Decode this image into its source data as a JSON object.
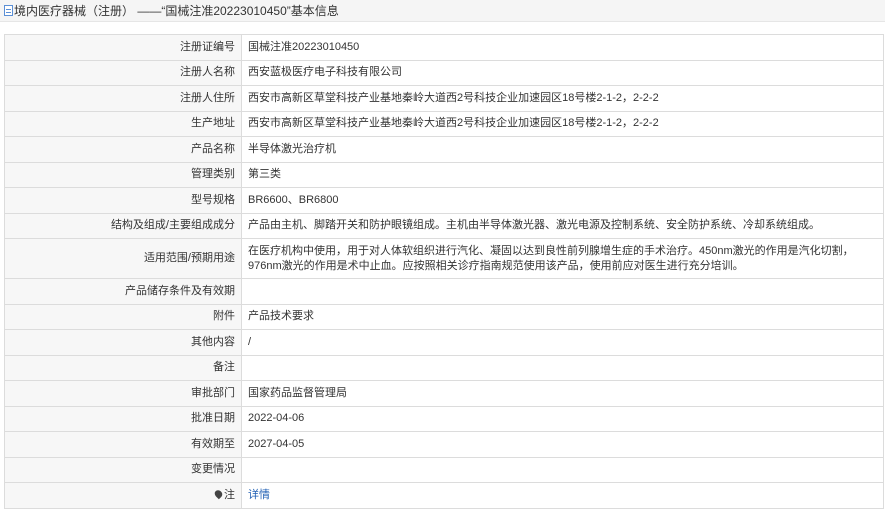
{
  "header": {
    "title": "境内医疗器械（注册） ——“国械注准20223010450”基本信息"
  },
  "rows": [
    {
      "label": "注册证编号",
      "value": "国械注准20223010450"
    },
    {
      "label": "注册人名称",
      "value": "西安蓝极医疗电子科技有限公司"
    },
    {
      "label": "注册人住所",
      "value": "西安市高新区草堂科技产业基地秦岭大道西2号科技企业加速园区18号楼2-1-2，2-2-2"
    },
    {
      "label": "生产地址",
      "value": "西安市高新区草堂科技产业基地秦岭大道西2号科技企业加速园区18号楼2-1-2，2-2-2"
    },
    {
      "label": "产品名称",
      "value": "半导体激光治疗机"
    },
    {
      "label": "管理类别",
      "value": "第三类"
    },
    {
      "label": "型号规格",
      "value": "BR6600、BR6800"
    },
    {
      "label": "结构及组成/主要组成成分",
      "value": "产品由主机、脚踏开关和防护眼镜组成。主机由半导体激光器、激光电源及控制系统、安全防护系统、冷却系统组成。"
    },
    {
      "label": "适用范围/预期用途",
      "value": "在医疗机构中使用，用于对人体软组织进行汽化、凝固以达到良性前列腺增生症的手术治疗。450nm激光的作用是汽化切割，976nm激光的作用是术中止血。应按照相关诊疗指南规范使用该产品，使用前应对医生进行充分培训。"
    },
    {
      "label": "产品储存条件及有效期",
      "value": ""
    },
    {
      "label": "附件",
      "value": "产品技术要求"
    },
    {
      "label": "其他内容",
      "value": "/"
    },
    {
      "label": "备注",
      "value": ""
    },
    {
      "label": "审批部门",
      "value": "国家药品监督管理局"
    },
    {
      "label": "批准日期",
      "value": "2022-04-06"
    },
    {
      "label": "有效期至",
      "value": "2027-04-05"
    },
    {
      "label": "变更情况",
      "value": ""
    },
    {
      "label": "注",
      "value": "详情"
    }
  ],
  "icons": {
    "title_icon": "document-icon",
    "note_icon": "pin-icon"
  },
  "colors": {
    "link": "#1f5fb4",
    "label_bg": "#f7f7f7",
    "border": "#dcdcdc"
  }
}
